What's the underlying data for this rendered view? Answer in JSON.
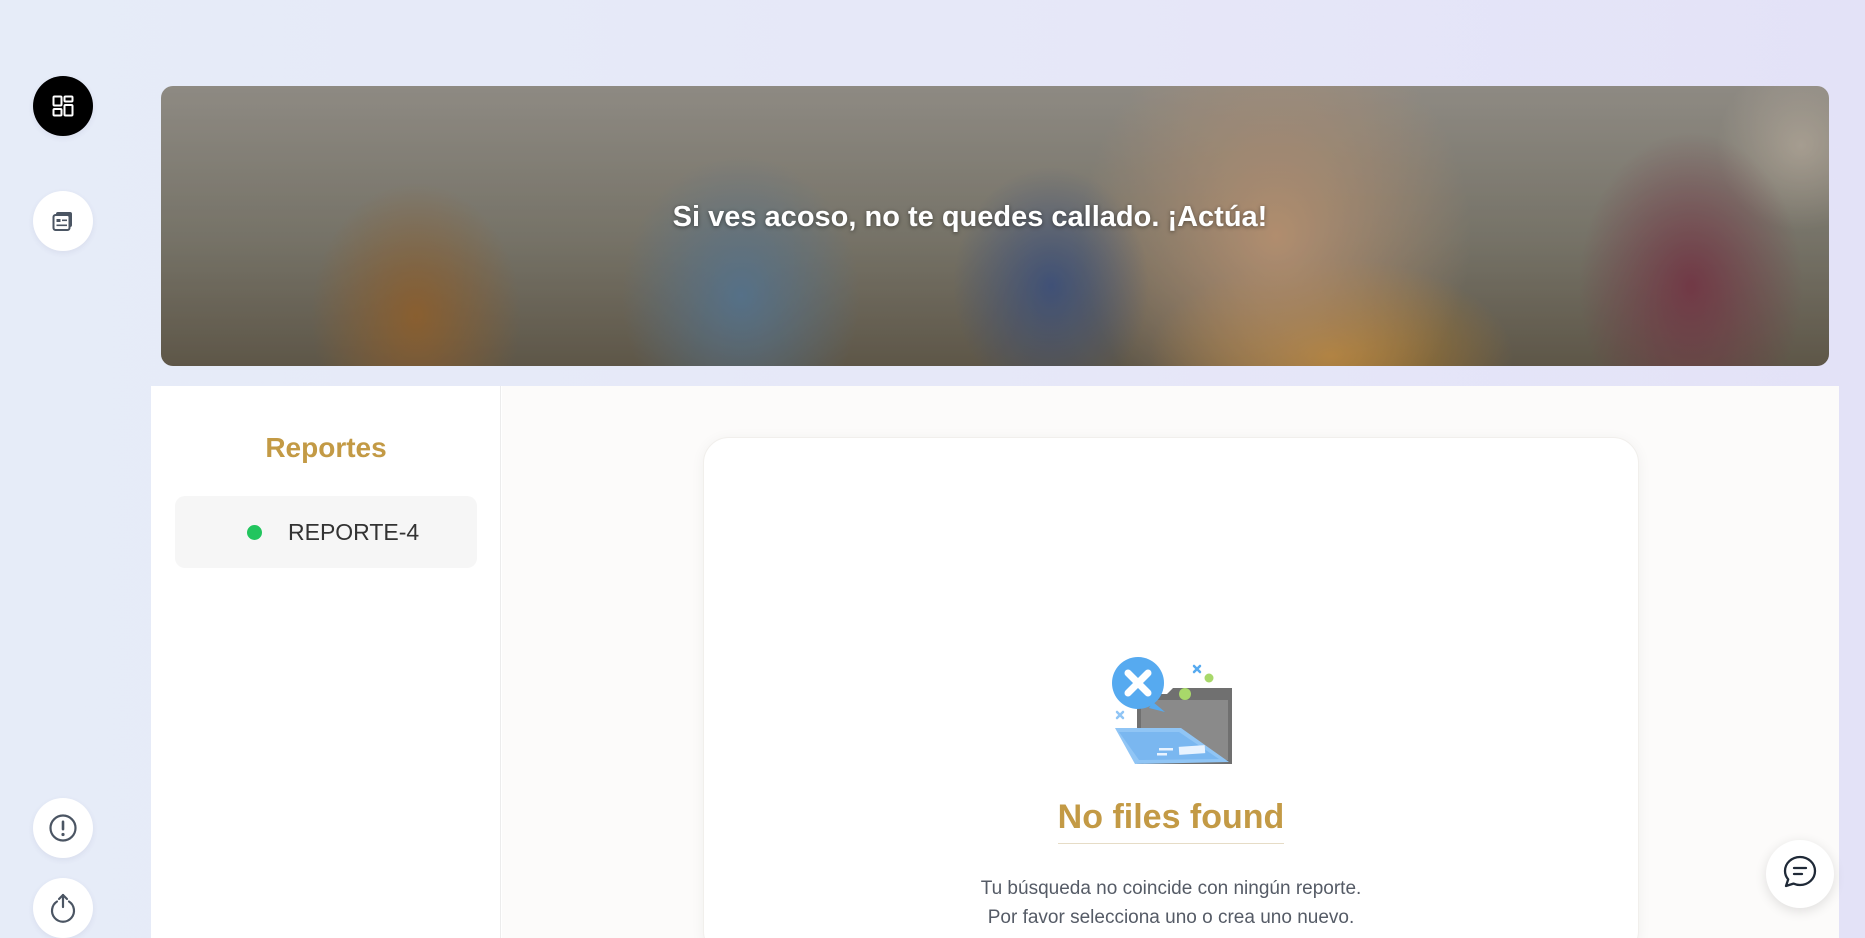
{
  "sidebar_nav": {
    "items": [
      {
        "icon": "dashboard-icon",
        "active": true
      },
      {
        "icon": "reports-icon",
        "active": false
      },
      {
        "icon": "alert-icon",
        "active": false
      },
      {
        "icon": "power-icon",
        "active": false
      }
    ]
  },
  "hero": {
    "message": "Si ves acoso, no te quedes callado. ¡Actúa!"
  },
  "reports": {
    "title": "Reportes",
    "items": [
      {
        "label": "REPORTE-4",
        "status_color": "#22c55e"
      }
    ]
  },
  "empty_state": {
    "icon": "no-files-illustration",
    "title": "No files found",
    "line1": "Tu búsqueda no coincide con ningún reporte.",
    "line2": "Por favor selecciona uno o crea uno nuevo."
  },
  "chat": {
    "icon": "chat-icon"
  },
  "colors": {
    "accent_gold": "#c39a45",
    "status_active": "#22c55e",
    "nav_active": "#000000"
  }
}
